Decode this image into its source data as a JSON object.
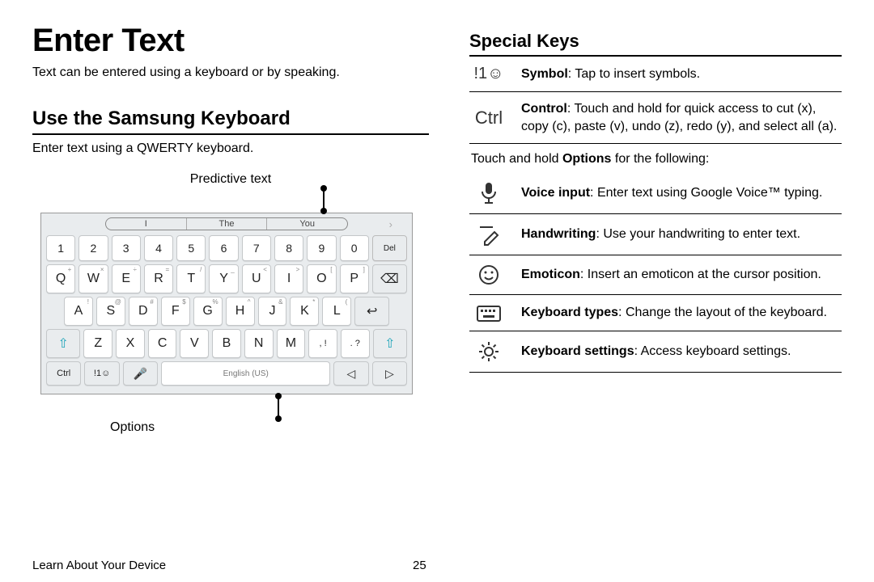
{
  "title": "Enter Text",
  "intro": "Text can be entered using a keyboard or by speaking.",
  "section1": {
    "heading": "Use the Samsung Keyboard",
    "sub": "Enter text using a QWERTY keyboard.",
    "callout_top": "Predictive text",
    "callout_bottom": "Options"
  },
  "keyboard": {
    "predictions": [
      "I",
      "The",
      "You"
    ],
    "row_num": [
      "1",
      "2",
      "3",
      "4",
      "5",
      "6",
      "7",
      "8",
      "9",
      "0"
    ],
    "del": "Del",
    "row1": [
      "Q",
      "W",
      "E",
      "R",
      "T",
      "Y",
      "U",
      "I",
      "O",
      "P"
    ],
    "sup1": [
      "+",
      "×",
      "÷",
      "=",
      "/",
      "_",
      "<",
      ">",
      "[",
      "]"
    ],
    "row2": [
      "A",
      "S",
      "D",
      "F",
      "G",
      "H",
      "J",
      "K",
      "L"
    ],
    "sup2": [
      "!",
      "@",
      "#",
      "$",
      "%",
      "^",
      "&",
      "*",
      "("
    ],
    "row3": [
      "Z",
      "X",
      "C",
      "V",
      "B",
      "N",
      "M"
    ],
    "punct1": ", !",
    "punct2": ". ?",
    "ctrl": "Ctrl",
    "sym": "!1☺",
    "space": "English (US)"
  },
  "section2": {
    "heading": "Special Keys",
    "items": [
      {
        "icon_text": "!1☺",
        "bold": "Symbol",
        "rest": ": Tap to insert symbols."
      },
      {
        "icon_text": "Ctrl",
        "bold": "Control",
        "rest": ": Touch and hold for quick access to cut (x), copy (c), paste (v), undo (z), redo (y), and select all (a)."
      }
    ],
    "hold_note_pre": "Touch and hold ",
    "hold_note_bold": "Options",
    "hold_note_post": " for the following:",
    "hold_items": [
      {
        "icon": "mic",
        "bold": "Voice input",
        "rest": ": Enter text using Google Voice™ typing."
      },
      {
        "icon": "handwriting",
        "bold": "Handwriting",
        "rest": ": Use your handwriting to enter text."
      },
      {
        "icon": "emoticon",
        "bold": "Emoticon",
        "rest": ": Insert an emoticon at the cursor position."
      },
      {
        "icon": "keyboard",
        "bold": "Keyboard types",
        "rest": ": Change the layout of the keyboard."
      },
      {
        "icon": "settings",
        "bold": "Keyboard settings",
        "rest": ": Access keyboard settings."
      }
    ]
  },
  "footer": {
    "section": "Learn About Your Device",
    "page": "25"
  }
}
